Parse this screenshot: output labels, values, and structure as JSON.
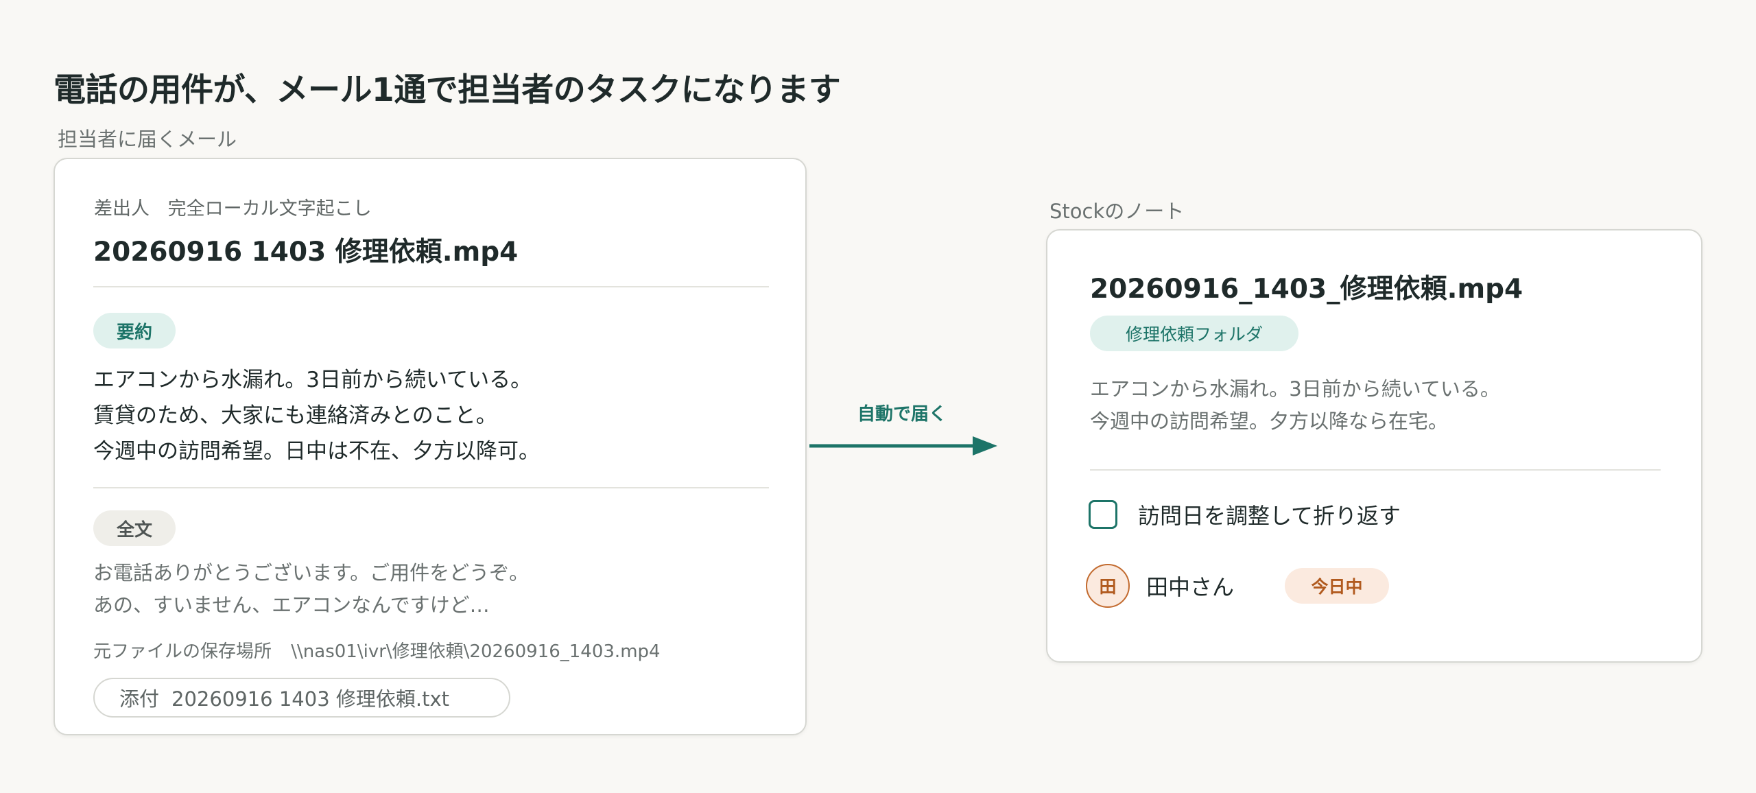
{
  "title": "電話の用件が、メール1通で担当者のタスクになります",
  "email": {
    "section_label": "担当者に届くメール",
    "sender_key": "差出人",
    "sender_value": "完全ローカル文字起こし",
    "subject": "20260916 1403 修理依頼.mp4",
    "summary_tag": "要約",
    "summary_lines": [
      "エアコンから水漏れ。3日前から続いている。",
      "賃貸のため、大家にも連絡済みとのこと。",
      "今週中の訪問希望。日中は不在、夕方以降可。"
    ],
    "full_tag": "全文",
    "full_lines": [
      "お電話ありがとうございます。ご用件をどうぞ。",
      "あの、すいません、エアコンなんですけど…"
    ],
    "filepath_key": "元ファイルの保存場所",
    "filepath_value": "\\\\nas01\\ivr\\修理依頼\\20260916_1403.mp4",
    "attach_key": "添付",
    "attach_value": "20260916 1403 修理依頼.txt"
  },
  "arrow": {
    "label": "自動で届く",
    "color": "#1d7468"
  },
  "stock": {
    "section_label": "Stockのノート",
    "title": "20260916_1403_修理依頼.mp4",
    "folder_tag": "修理依頼フォルダ",
    "lines": [
      "エアコンから水漏れ。3日前から続いている。",
      "今週中の訪問希望。夕方以降なら在宅。"
    ],
    "task_label": "訪問日を調整して折り返す",
    "task_done": false,
    "avatar_initial": "田",
    "assignee": "田中さん",
    "due": "今日中"
  },
  "colors": {
    "accent": "#1d7468",
    "accent_bg": "#e0f1ed",
    "warm": "#b15a1e",
    "warm_bg": "#fbeadf"
  }
}
